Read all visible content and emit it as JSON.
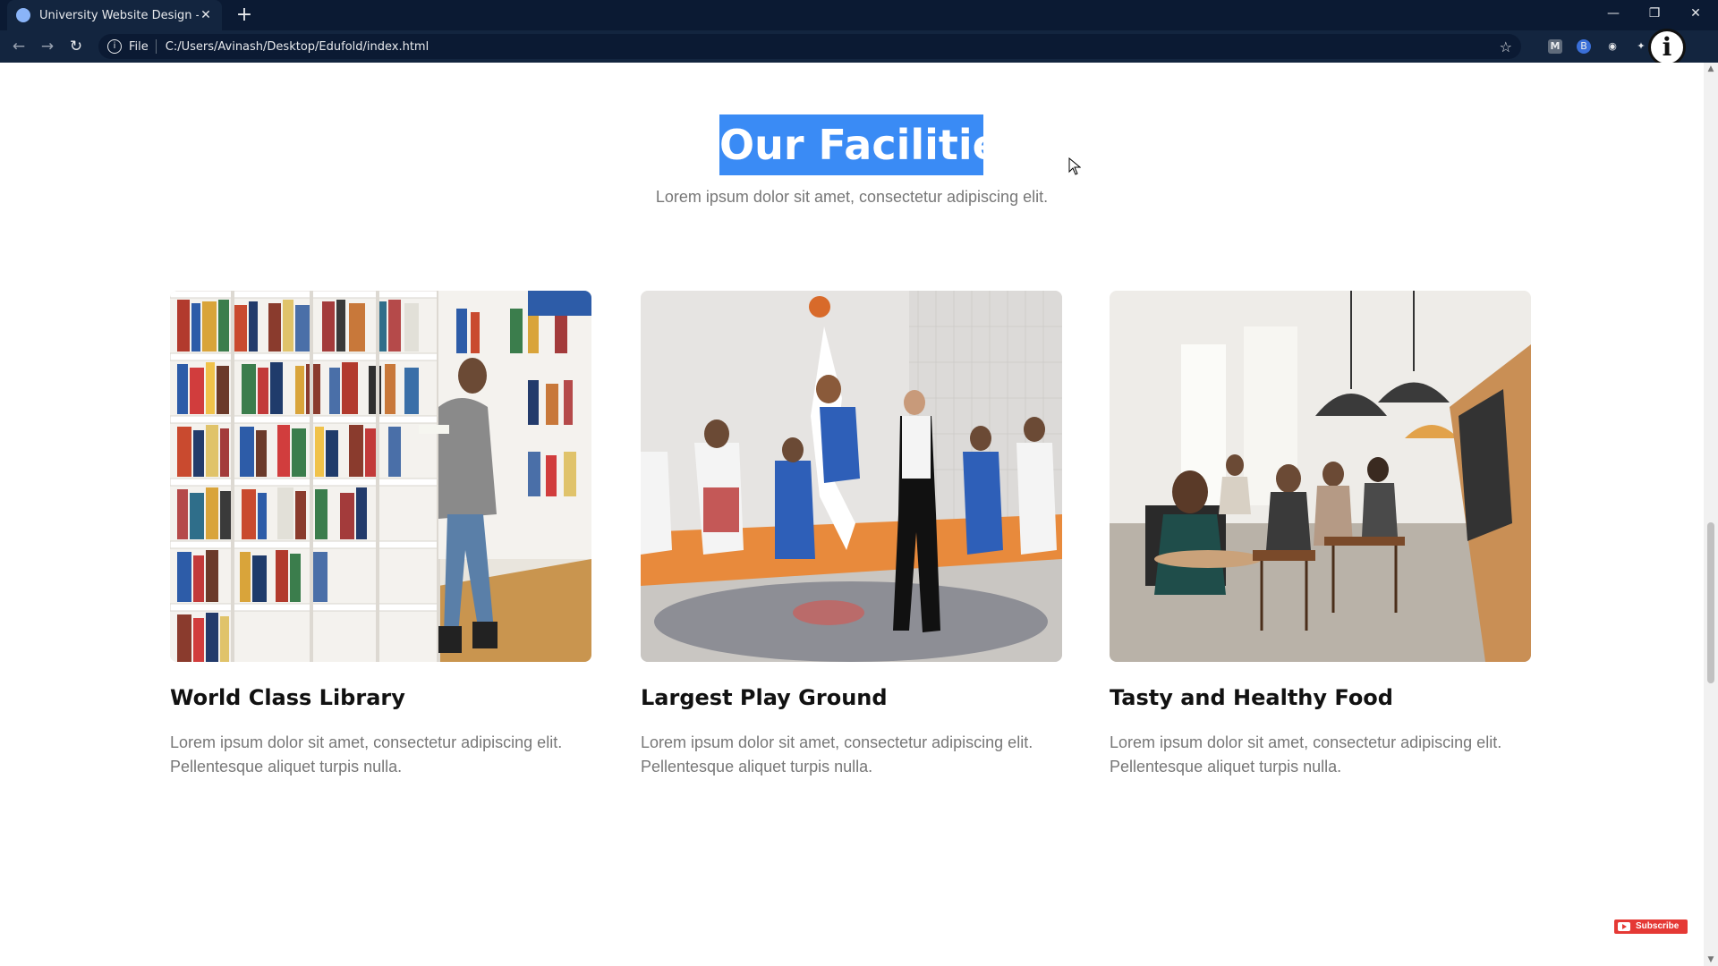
{
  "browser": {
    "tab_title": "University Website Design - Easy",
    "tab_close": "✕",
    "new_tab": "+",
    "scheme_label": "File",
    "url": "C:/Users/Avinash/Desktop/Edufold/index.html",
    "profile_glyph": "i",
    "extensions": [
      "M",
      "B",
      "camera-icon",
      "puzzle-icon"
    ]
  },
  "section": {
    "title": "Our Facilities",
    "subtitle": "Lorem ipsum dolor sit amet, consectetur adipiscing elit."
  },
  "cards": [
    {
      "title": "World Class Library",
      "text": "Lorem ipsum dolor sit amet, consectetur adipiscing elit. Pellentesque aliquet turpis nulla.",
      "image": "library-photo"
    },
    {
      "title": "Largest Play Ground",
      "text": "Lorem ipsum dolor sit amet, consectetur adipiscing elit. Pellentesque aliquet turpis nulla.",
      "image": "basketball-photo"
    },
    {
      "title": "Tasty and Healthy Food",
      "text": "Lorem ipsum dolor sit amet, consectetur adipiscing elit. Pellentesque aliquet turpis nulla.",
      "image": "cafe-photo"
    }
  ],
  "subscribe_label": "Subscribe",
  "colors": {
    "highlight": "#3a8bf5",
    "heading_text": "#111111",
    "body_text": "#777777",
    "chrome_dark": "#0b1a33"
  }
}
